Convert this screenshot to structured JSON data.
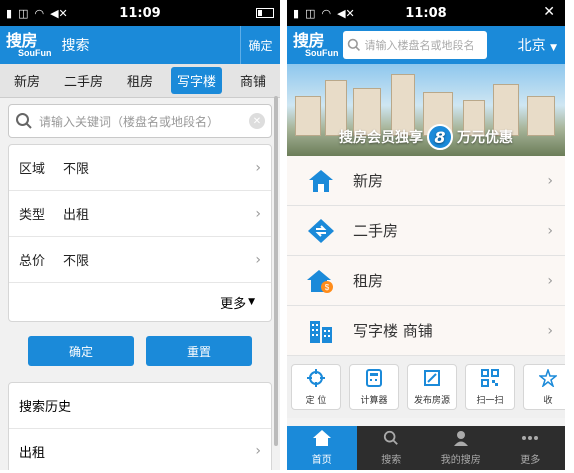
{
  "left": {
    "status": {
      "time": "11:09"
    },
    "appbar": {
      "logo": "搜房",
      "logo_sub": "SouFun",
      "title": "搜索",
      "confirm": "确定"
    },
    "tabs": [
      "新房",
      "二手房",
      "租房",
      "写字楼",
      "商铺"
    ],
    "active_tab": 3,
    "search": {
      "placeholder": "请输入关键词（楼盘名或地段名）"
    },
    "filters": [
      {
        "label": "区域",
        "value": "不限"
      },
      {
        "label": "类型",
        "value": "出租"
      },
      {
        "label": "总价",
        "value": "不限"
      }
    ],
    "more": "更多",
    "buttons": {
      "confirm": "确定",
      "reset": "重置"
    },
    "history": {
      "title": "搜索历史",
      "items": [
        "出租"
      ]
    }
  },
  "right": {
    "status": {
      "time": "11:08"
    },
    "appbar": {
      "logo": "搜房",
      "logo_sub": "SouFun",
      "search_placeholder": "请输入楼盘名或地段名",
      "city": "北京"
    },
    "banner": {
      "pre": "搜房会员独享",
      "num": "8",
      "post": "万元优惠"
    },
    "menu": [
      "新房",
      "二手房",
      "租房",
      "写字楼  商铺"
    ],
    "quick": [
      "定 位",
      "计算器",
      "发布房源",
      "扫一扫",
      "收"
    ],
    "nav": [
      "首页",
      "搜索",
      "我的搜房",
      "更多"
    ],
    "active_nav": 0
  },
  "colors": {
    "brand": "#1b8ad9",
    "nav_bg": "#2d2d2d"
  }
}
